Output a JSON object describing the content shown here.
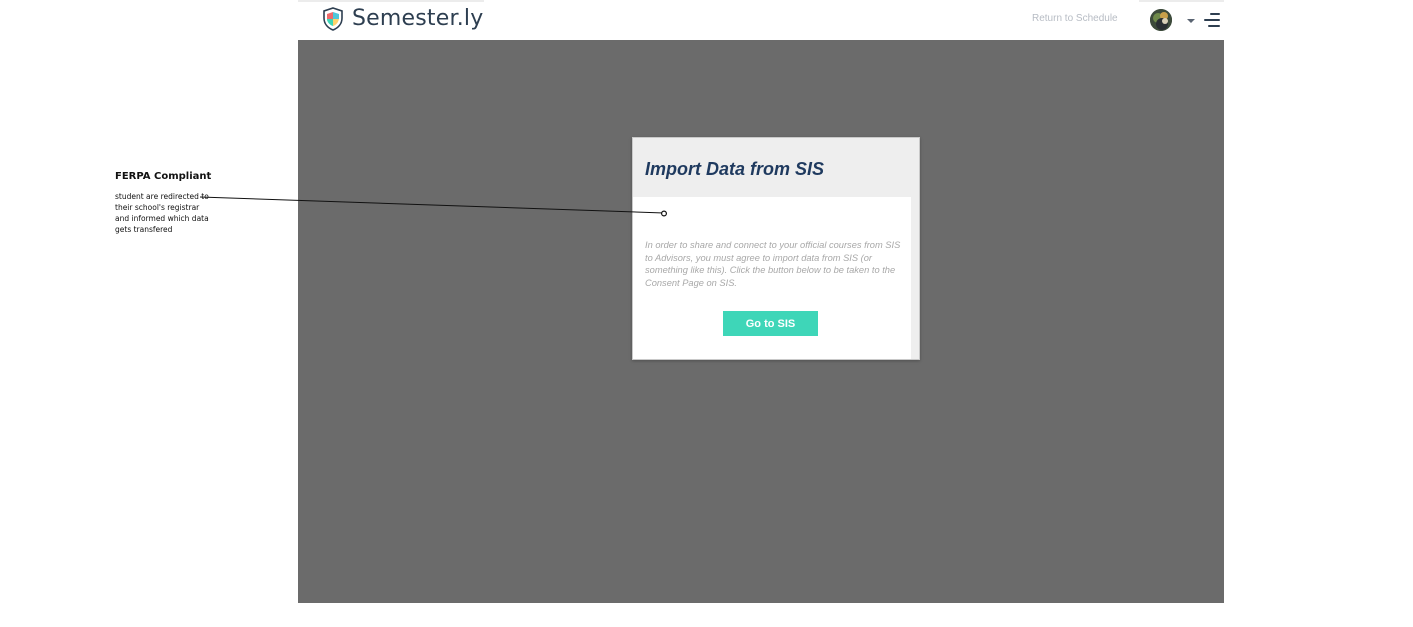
{
  "annotation": {
    "title": "FERPA Compliant",
    "body": "student are redirected to their school's registrar and informed which data gets transfered"
  },
  "header": {
    "logo_text": "Semester.ly",
    "return_link": "Return to Schedule",
    "logo_icon": "shield-icon",
    "menu_icon": "hamburger-menu-icon",
    "avatar_icon": "user-avatar"
  },
  "modal": {
    "title": "Import Data from SIS",
    "body": "In order to share and connect to your official courses from SIS to Advisors, you must agree to import data from SIS (or something like this). Click the button below to be taken to the Consent Page on SIS.",
    "button_label": "Go to SIS"
  },
  "colors": {
    "overlay": "#6b6b6b",
    "accent_button": "#3ed6b8",
    "title_text": "#1f3a5f",
    "body_text": "#a8a8a8",
    "header_text": "#2d3e50"
  }
}
